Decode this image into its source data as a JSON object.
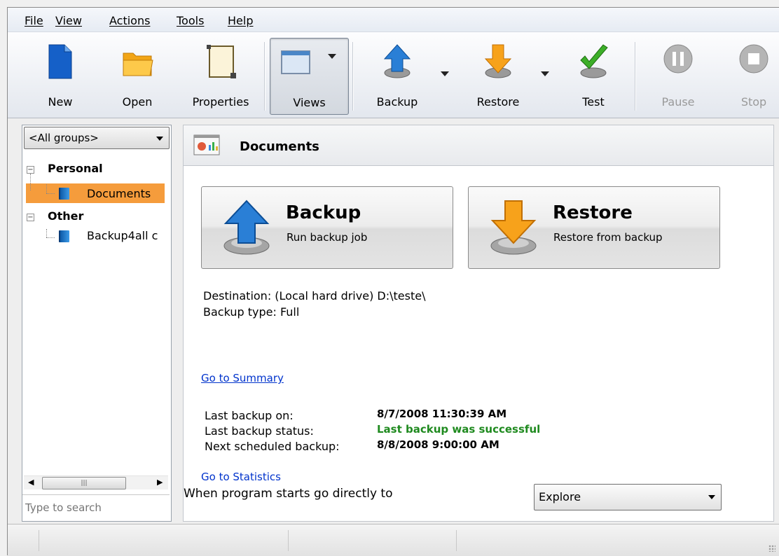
{
  "menu": [
    "File",
    "View",
    "Actions",
    "Tools",
    "Help"
  ],
  "toolbar": {
    "new": "New",
    "open": "Open",
    "properties": "Properties",
    "views": "Views",
    "backup": "Backup",
    "restore": "Restore",
    "test": "Test",
    "pause": "Pause",
    "stop": "Stop"
  },
  "sidebar": {
    "group_select": "<All groups>",
    "tree": {
      "personal": "Personal",
      "documents": "Documents",
      "other": "Other",
      "backup4all": "Backup4all c"
    },
    "search_placeholder": "Type to search"
  },
  "main": {
    "title": "Documents",
    "backup_button": {
      "title": "Backup",
      "subtitle": "Run backup job"
    },
    "restore_button": {
      "title": "Restore",
      "subtitle": "Restore from backup"
    },
    "destination": "Destination: (Local hard drive) D:\\teste\\",
    "backup_type": "Backup type: Full",
    "go_to_summary": "Go to Summary",
    "stats": {
      "last_backup_label": "Last backup on:",
      "last_backup_value": "8/7/2008 11:30:39 AM",
      "status_label": "Last backup status:",
      "status_value": "Last backup was successful",
      "next_label": "Next scheduled backup:",
      "next_value": "8/8/2008 9:00:00 AM"
    },
    "go_to_statistics": "Go to Statistics",
    "startup_label": "When program starts go directly to",
    "startup_value": "Explore"
  },
  "colors": {
    "selection": "#f59c3c",
    "link": "#0033cc",
    "success": "#1f8a1f"
  },
  "icons": {
    "new": "new-document-icon",
    "open": "folder-icon",
    "properties": "properties-icon",
    "views": "views-icon",
    "backup": "backup-arrow-up-icon",
    "restore": "restore-arrow-down-icon",
    "test": "checkmark-icon",
    "pause": "pause-icon",
    "stop": "stop-icon"
  }
}
